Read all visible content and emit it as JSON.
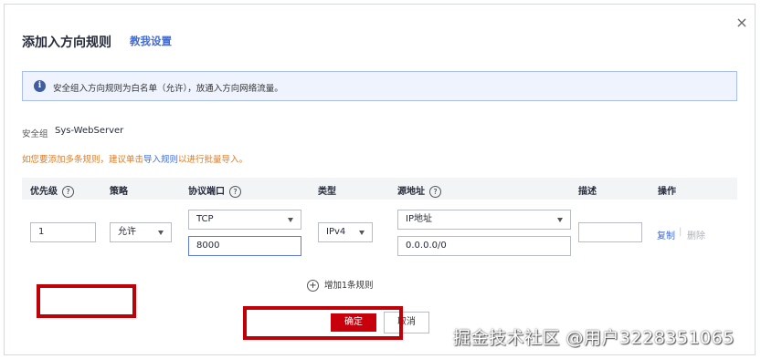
{
  "dialog": {
    "title": "添加入方向规则",
    "help_link": "教我设置",
    "close_glyph": "×"
  },
  "info_banner": {
    "icon": "info-icon",
    "text": "安全组入方向规则为白名单（允许），放通入方向网络流量。"
  },
  "security_group": {
    "label": "安全组",
    "name": "Sys-WebServer"
  },
  "hint": {
    "prefix": "如您要添加多条规则，建议单击",
    "link": "导入规则",
    "suffix": "以进行批量导入。"
  },
  "table": {
    "headers": {
      "priority": "优先级",
      "policy": "策略",
      "protocol_port": "协议端口",
      "type": "类型",
      "source_address": "源地址",
      "description": "描述",
      "actions": "操作"
    },
    "help_glyph": "?",
    "row": {
      "priority": "1",
      "policy": "允许",
      "protocol": "TCP",
      "port": "8000",
      "type": "IPv4",
      "source_type": "IP地址",
      "source_value": "0.0.0.0/0",
      "description": "",
      "copy": "复制",
      "delete": "删除"
    }
  },
  "add_rule": {
    "label": "增加1条规则",
    "icon": "plus-circle-icon"
  },
  "footer": {
    "ok": "确定",
    "cancel": "取消"
  },
  "colors": {
    "primary_red": "#c7000b",
    "link_blue": "#3f6bd8",
    "hint_orange": "#e07b25",
    "annotation_red": "#c00006"
  },
  "watermark": "掘金技术社区 @用户3228351065"
}
